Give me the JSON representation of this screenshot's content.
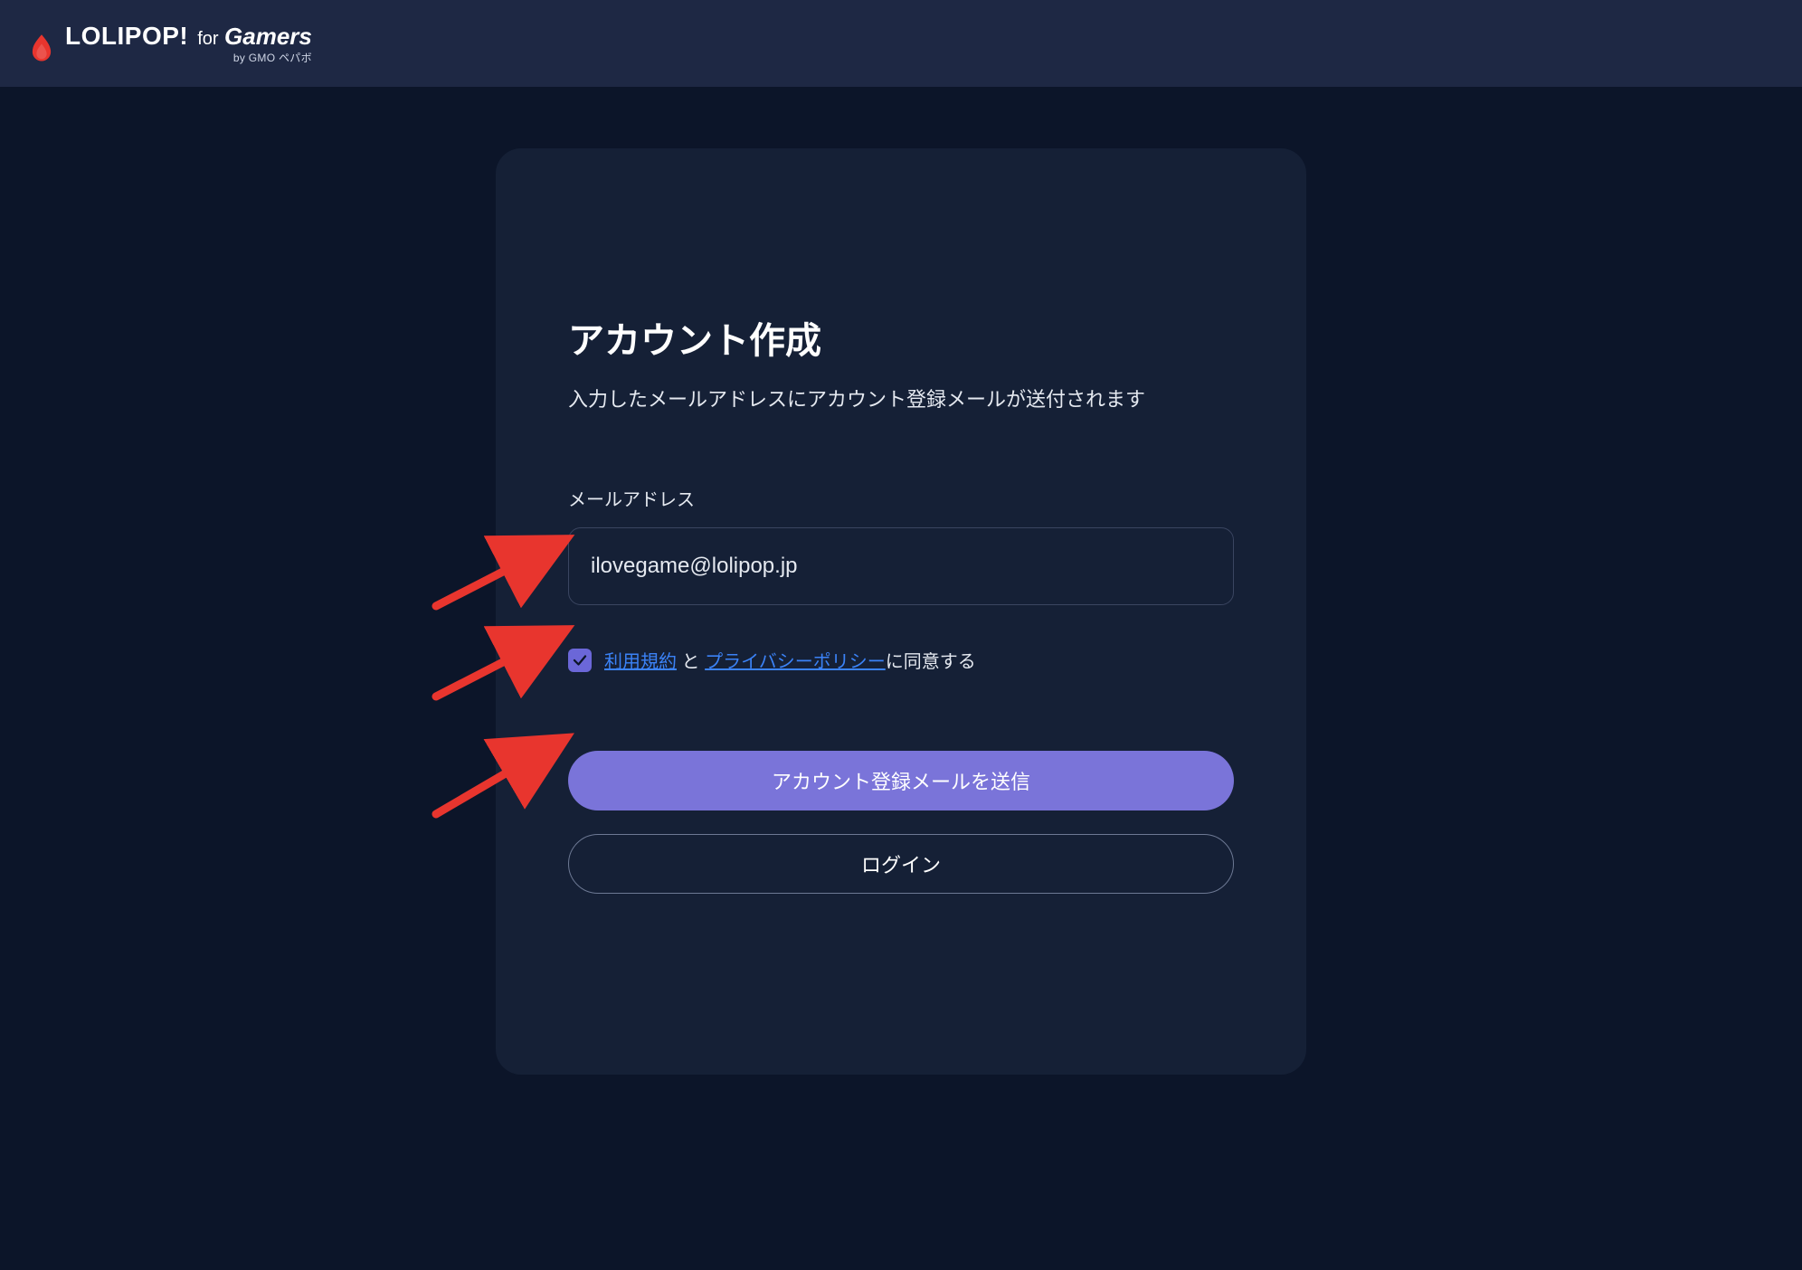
{
  "header": {
    "brand_primary": "LOLIPOP!",
    "brand_for": "for",
    "brand_gamers": "Gamers",
    "brand_sub": "by GMO ペパボ"
  },
  "card": {
    "title": "アカウント作成",
    "subtitle": "入力したメールアドレスにアカウント登録メールが送付されます",
    "email_label": "メールアドレス",
    "email_value": "ilovegame@lolipop.jp",
    "consent": {
      "checked": true,
      "terms_link": "利用規約",
      "joiner_1": " と ",
      "privacy_link": "プライバシーポリシー",
      "tail": "に同意する"
    },
    "submit_label": "アカウント登録メールを送信",
    "login_label": "ログイン"
  },
  "colors": {
    "accent": "#7a74d9",
    "link": "#3b82f6",
    "arrow": "#e8352e"
  }
}
